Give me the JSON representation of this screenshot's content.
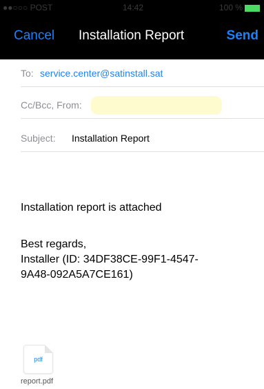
{
  "status_bar": {
    "carrier": "●●○○○ POST",
    "time": "14:42",
    "battery": "100 %"
  },
  "nav": {
    "cancel_label": "Cancel",
    "title": "Installation Report",
    "send_label": "Send"
  },
  "compose": {
    "to_label": "To:",
    "to_value": "service.center@satinstall.sat",
    "cc_label": "Cc/Bcc, From:",
    "subject_label": "Subject:",
    "subject_value": "Installation Report"
  },
  "message": {
    "line1": "Installation report is attached",
    "regards": "Best regards,",
    "installer_line1": "Installer (ID: 34DF38CE-99F1-4547-",
    "installer_line2": "9A48-092A5A7CE161)"
  },
  "attachment": {
    "icon_text": "pdf",
    "file_name": "report.pdf"
  },
  "colors": {
    "accent": "#1a82fb",
    "highlight": "#fefbcf"
  }
}
